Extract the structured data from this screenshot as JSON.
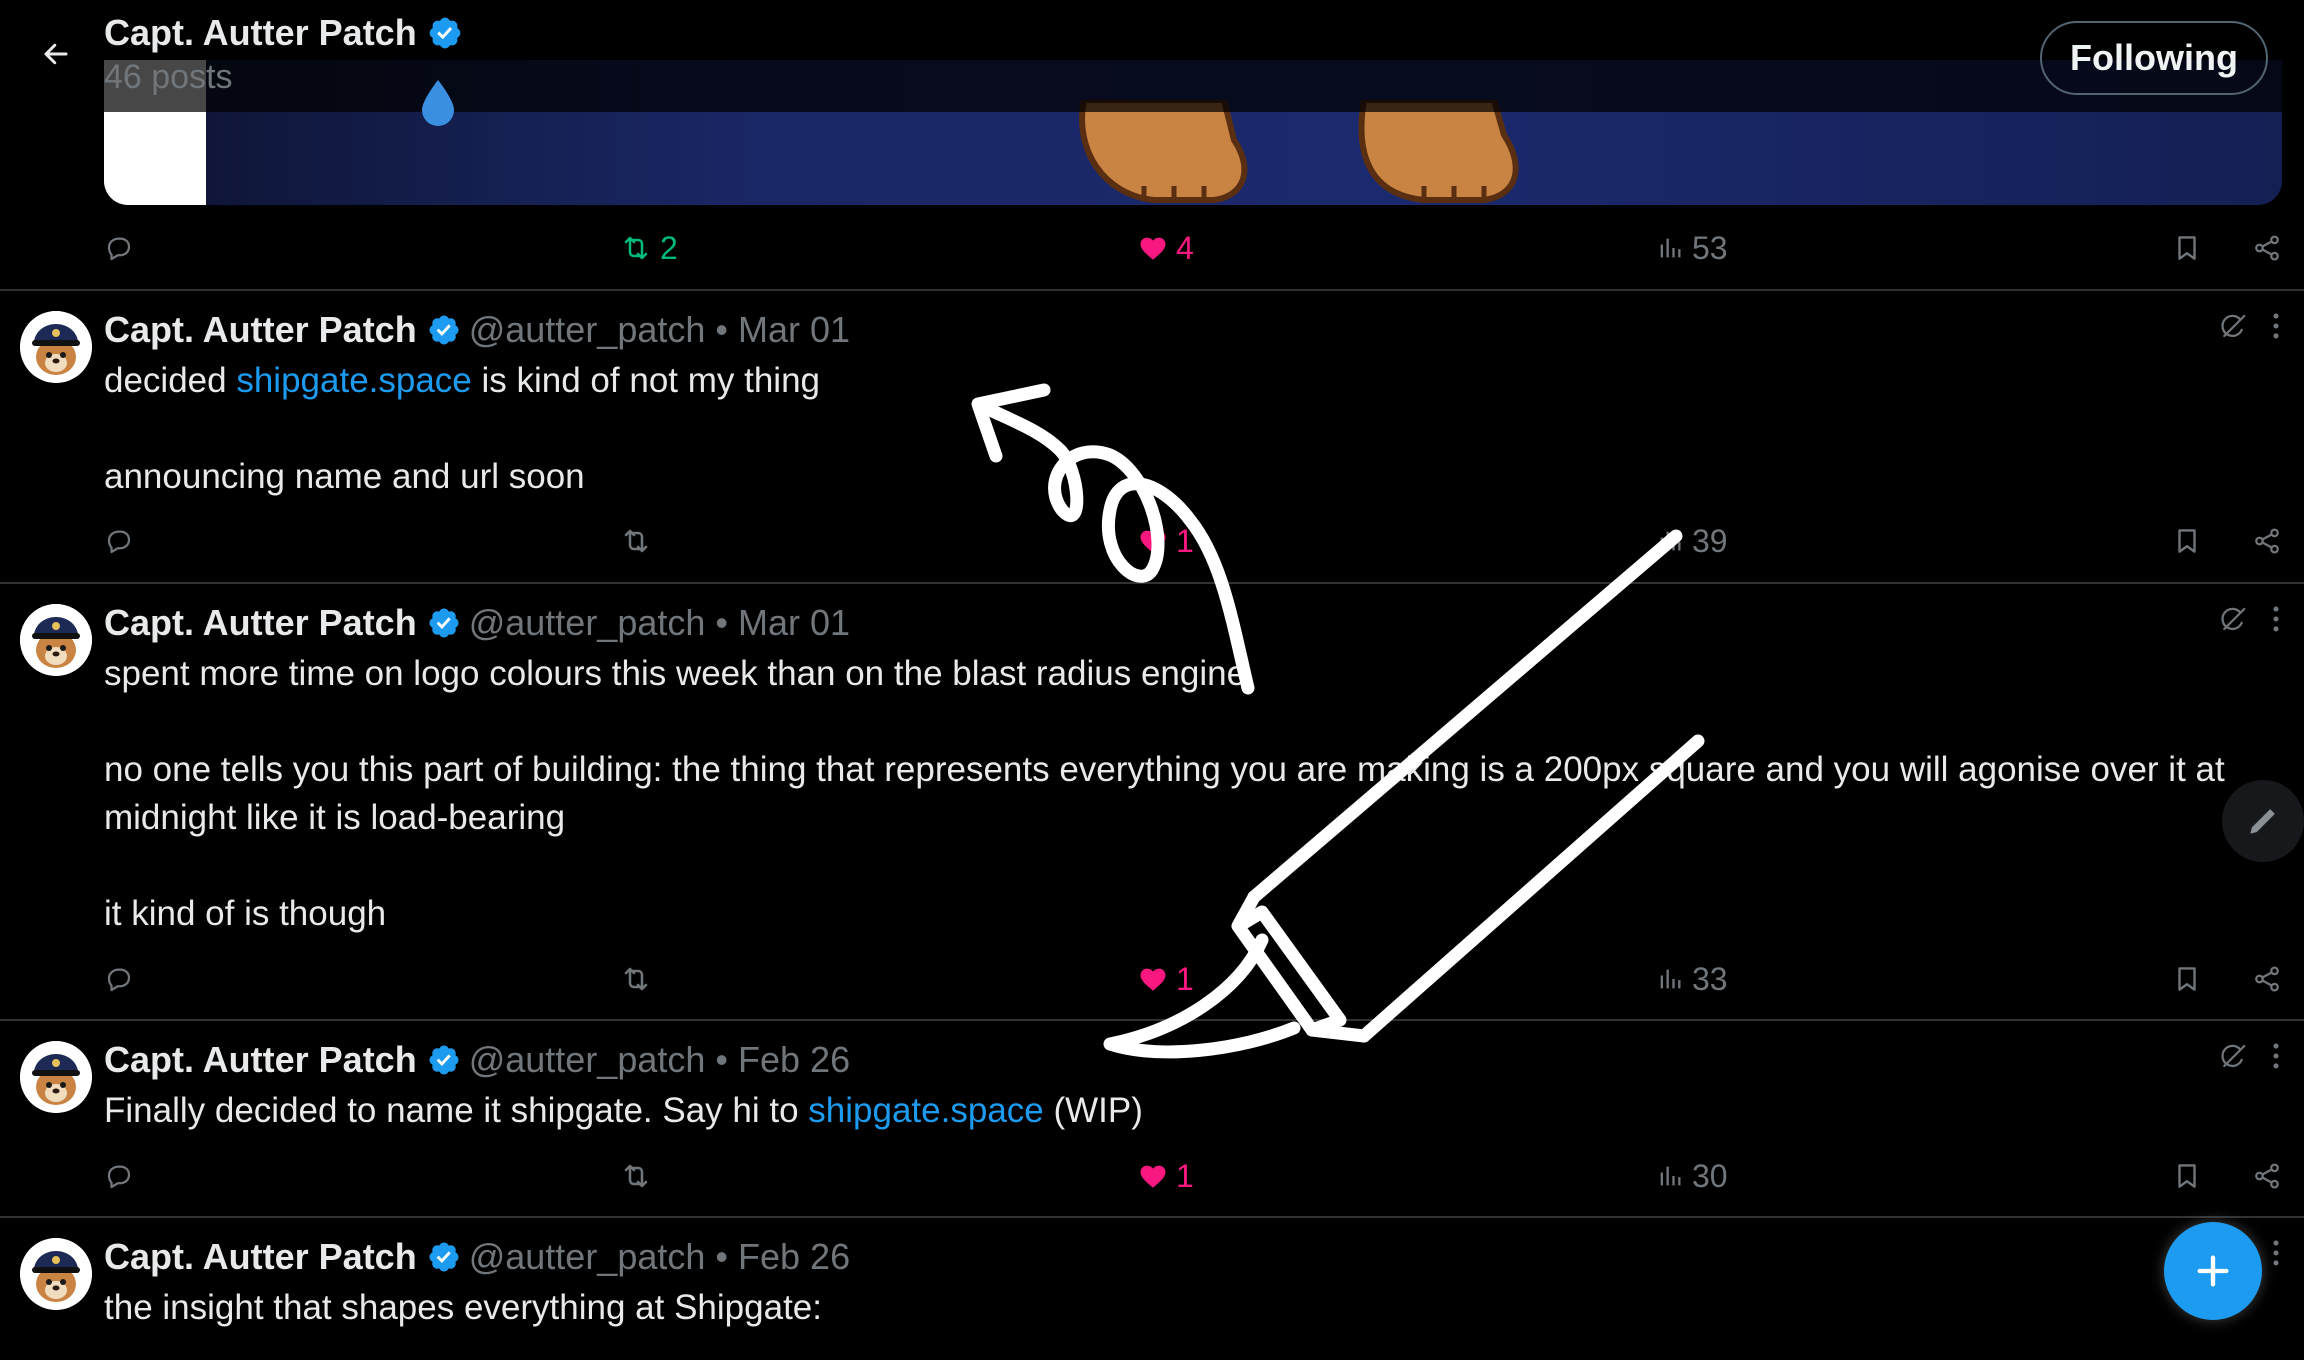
{
  "header": {
    "name": "Capt. Autter Patch",
    "posts_count": "46 posts",
    "follow_button": "Following"
  },
  "top_post_actions": {
    "reply": "",
    "retweets": "2",
    "likes": "4",
    "views": "53"
  },
  "tweets": [
    {
      "name": "Capt. Autter Patch",
      "handle": "@autter_patch",
      "separator": "•",
      "date": "Mar 01",
      "line1_before": "decided ",
      "line1_link": "shipgate.space",
      "line1_after": " is kind of not my thing",
      "line2": "announcing name and url soon",
      "actions": {
        "retweets": "",
        "likes": "1",
        "views": "39"
      }
    },
    {
      "name": "Capt. Autter Patch",
      "handle": "@autter_patch",
      "separator": "•",
      "date": "Mar 01",
      "para1": "spent more time on logo colours this week than on the blast radius engine",
      "para2": "no one tells you this part of building: the thing that represents everything you are making is a 200px square and you will agonise over it at midnight like it is load-bearing",
      "para3": "it kind of is though",
      "actions": {
        "retweets": "",
        "likes": "1",
        "views": "33"
      }
    },
    {
      "name": "Capt. Autter Patch",
      "handle": "@autter_patch",
      "separator": "•",
      "date": "Feb 26",
      "text_before": "Finally decided to name it shipgate. Say hi to ",
      "text_link": "shipgate.space",
      "text_after": " (WIP)",
      "actions": {
        "retweets": "",
        "likes": "1",
        "views": "30"
      }
    },
    {
      "name": "Capt. Autter Patch",
      "handle": "@autter_patch",
      "separator": "•",
      "date": "Feb 26",
      "text": "the insight that shapes everything at Shipgate:"
    }
  ],
  "colors": {
    "background": "#000000",
    "text": "#e7e9ea",
    "muted": "#71767b",
    "accent": "#1d9bf0",
    "like": "#f91880",
    "retweet": "#00ba7c",
    "divider": "#2f3336"
  },
  "icons": [
    "back-arrow-icon",
    "verified-badge-icon",
    "reply-icon",
    "retweet-icon",
    "heart-icon",
    "views-icon",
    "bookmark-icon",
    "share-icon",
    "grok-icon",
    "more-icon",
    "plus-icon",
    "pencil-icon"
  ]
}
